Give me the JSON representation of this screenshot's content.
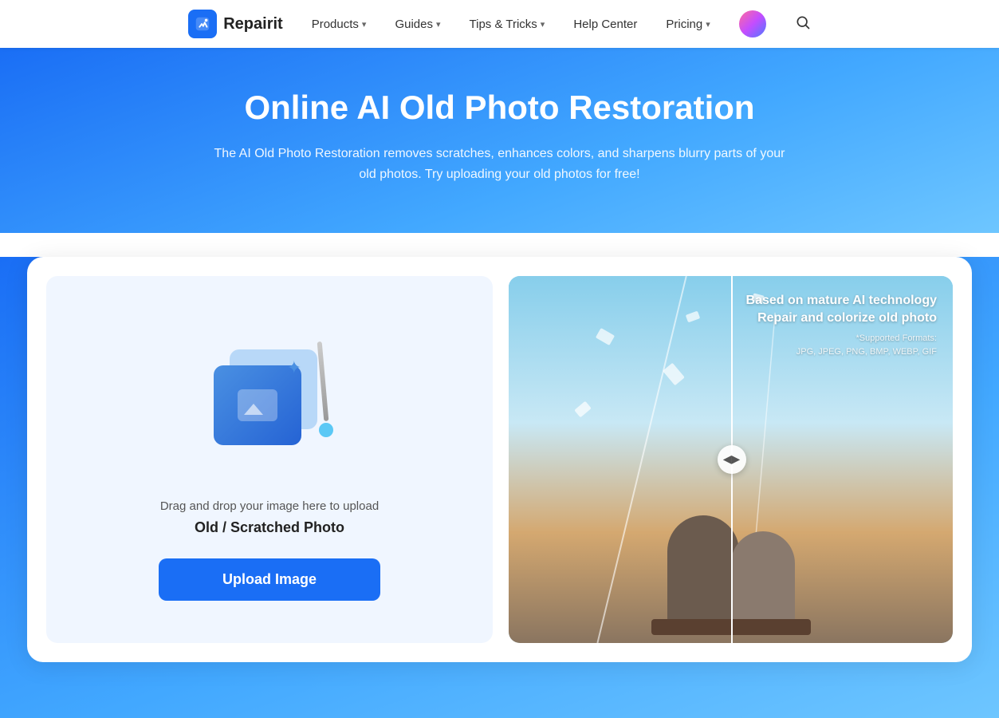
{
  "brand": {
    "name": "Repairit",
    "logo_alt": "Repairit logo"
  },
  "nav": {
    "items": [
      {
        "label": "Products",
        "has_dropdown": true
      },
      {
        "label": "Guides",
        "has_dropdown": true
      },
      {
        "label": "Tips & Tricks",
        "has_dropdown": true
      },
      {
        "label": "Help Center",
        "has_dropdown": false
      },
      {
        "label": "Pricing",
        "has_dropdown": true
      }
    ],
    "search_label": "Search"
  },
  "hero": {
    "title": "Online AI Old Photo Restoration",
    "subtitle": "The AI Old Photo Restoration removes scratches, enhances colors, and sharpens blurry parts of your old photos. Try uploading your old photos for free!"
  },
  "upload": {
    "drag_text": "Drag and drop your image here to upload",
    "file_type_label": "Old / Scratched Photo",
    "button_label": "Upload Image"
  },
  "preview": {
    "info_title": "Based on mature AI technology\nRepair and colorize old photo",
    "formats_label": "*Supported Formats:",
    "formats_list": "JPG, JPEG, PNG, BMP, WEBP, GIF",
    "divider_arrows": "◀▶"
  }
}
